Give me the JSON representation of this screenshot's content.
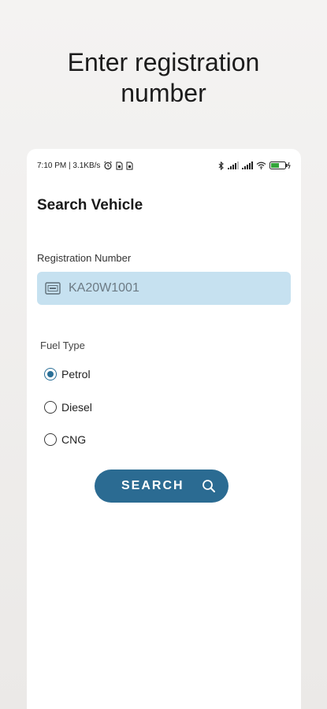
{
  "headline": [
    "Enter registration",
    "number"
  ],
  "status_bar": {
    "time_speed": "7:10 PM | 3.1KB/s",
    "icons": [
      "alarm-icon",
      "sim-icon",
      "sim-icon",
      "bluetooth-icon",
      "signal-icon",
      "signal-icon",
      "wifi-icon",
      "battery-icon"
    ]
  },
  "screen": {
    "title": "Search Vehicle",
    "registration_label": "Registration Number",
    "registration_value": "KA20W1001",
    "fuel_type_label": "Fuel Type",
    "fuel_options": [
      {
        "label": "Petrol",
        "selected": true
      },
      {
        "label": "Diesel",
        "selected": false
      },
      {
        "label": "CNG",
        "selected": false
      }
    ],
    "search_button": "SEARCH"
  },
  "colors": {
    "accent": "#2b6b92",
    "input_bg": "#c6e1f0"
  }
}
